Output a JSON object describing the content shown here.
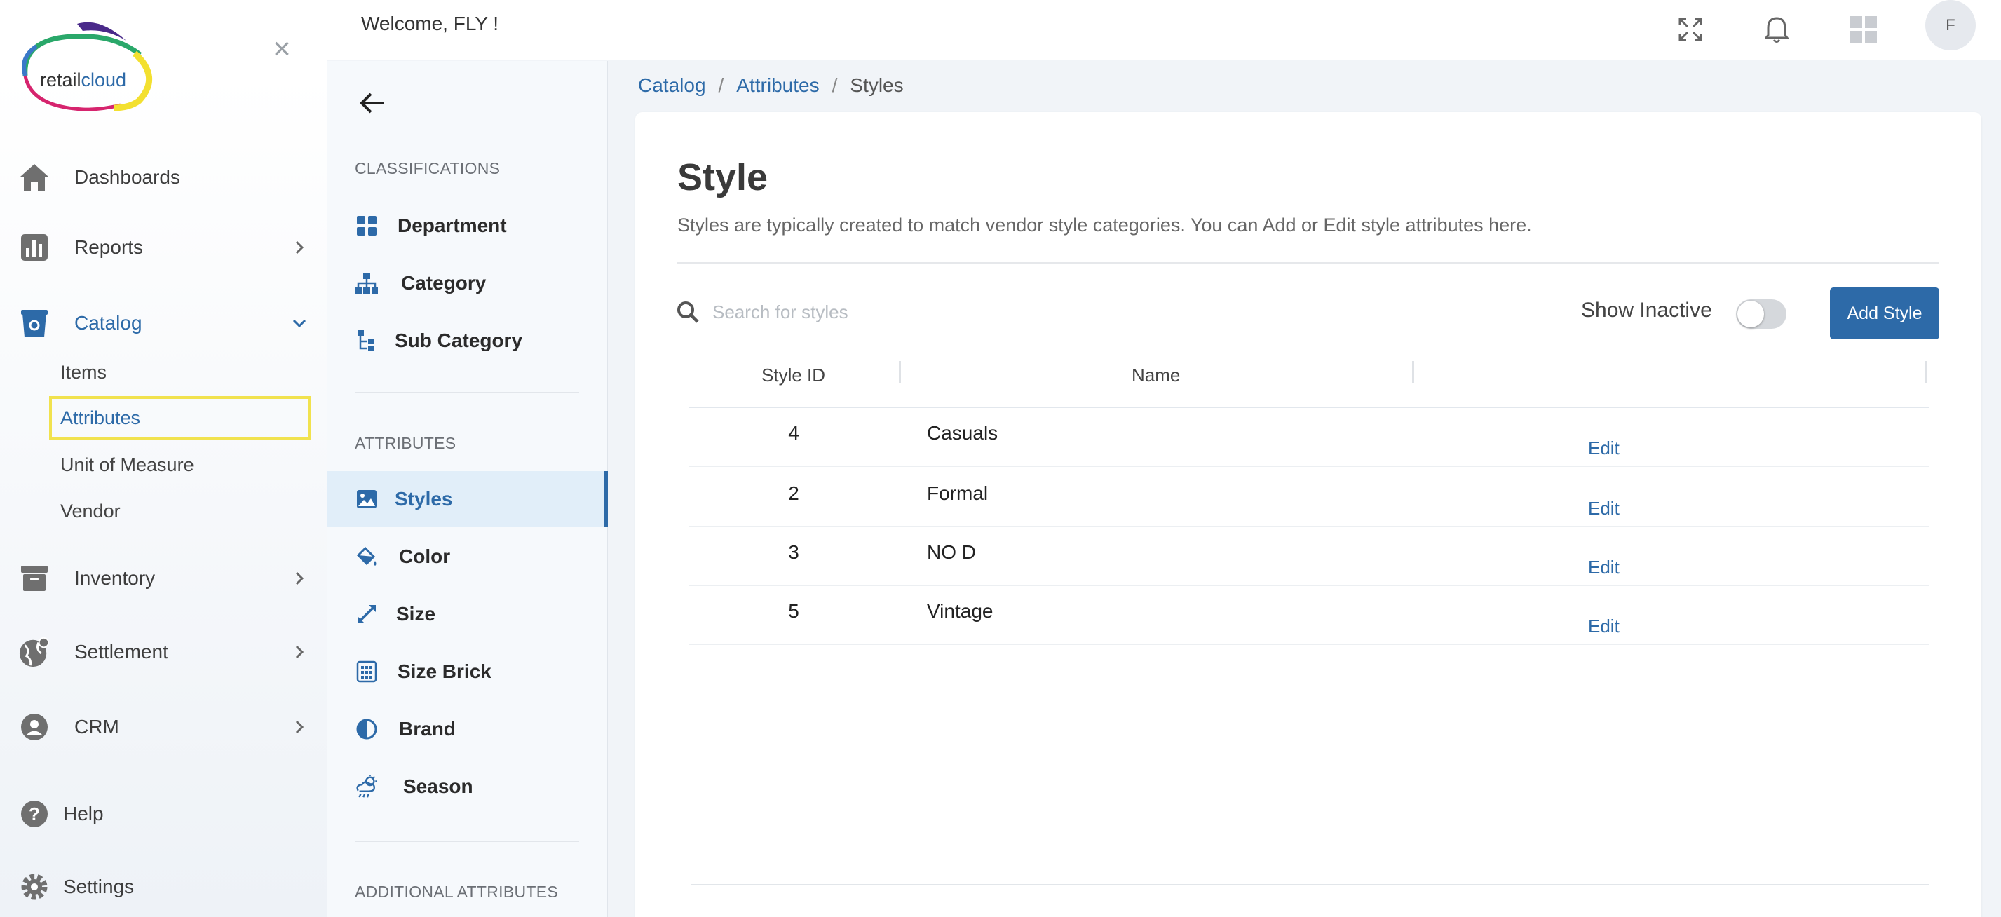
{
  "app": {
    "brand": "retailcloud",
    "brand_part1": "retail",
    "brand_part2": "cloud",
    "welcome": "Welcome, FLY !",
    "avatar_initial": "F"
  },
  "sidebar": {
    "items": [
      {
        "label": "Dashboards",
        "icon": "home-icon"
      },
      {
        "label": "Reports",
        "icon": "bar-chart-icon"
      },
      {
        "label": "Catalog",
        "icon": "catalog-bin-icon"
      },
      {
        "label": "Inventory",
        "icon": "archive-box-icon"
      },
      {
        "label": "Settlement",
        "icon": "globe-icon"
      },
      {
        "label": "CRM",
        "icon": "user-gear-icon"
      },
      {
        "label": "Help",
        "icon": "help-circle-icon"
      },
      {
        "label": "Settings",
        "icon": "gear-icon"
      }
    ],
    "catalog_sub": [
      "Items",
      "Attributes",
      "Unit of Measure",
      "Vendor"
    ]
  },
  "panel2": {
    "classifications_heading": "CLASSIFICATIONS",
    "classifications": [
      {
        "label": "Department",
        "icon": "grid-icon"
      },
      {
        "label": "Category",
        "icon": "hierarchy-icon"
      },
      {
        "label": "Sub Category",
        "icon": "tree-icon"
      }
    ],
    "attributes_heading": "ATTRIBUTES",
    "attributes": [
      {
        "label": "Styles",
        "icon": "image-icon"
      },
      {
        "label": "Color",
        "icon": "paint-bucket-icon"
      },
      {
        "label": "Size",
        "icon": "expand-arrows-icon"
      },
      {
        "label": "Size Brick",
        "icon": "calculator-icon"
      },
      {
        "label": "Brand",
        "icon": "contrast-icon"
      },
      {
        "label": "Season",
        "icon": "weather-icon"
      }
    ],
    "additional_heading": "ADDITIONAL ATTRIBUTES"
  },
  "breadcrumb": {
    "items": [
      "Catalog",
      "Attributes",
      "Styles"
    ],
    "separator": "/"
  },
  "page": {
    "title": "Style",
    "description": "Styles are typically created to match vendor style categories. You can Add or Edit style attributes here.",
    "search_placeholder": "Search for styles",
    "show_inactive_label": "Show Inactive",
    "show_inactive_on": false,
    "add_button": "Add Style"
  },
  "table": {
    "columns": [
      "Style ID",
      "Name",
      ""
    ],
    "rows": [
      {
        "id": "4",
        "name": "Casuals",
        "action": "Edit"
      },
      {
        "id": "2",
        "name": "Formal",
        "action": "Edit"
      },
      {
        "id": "3",
        "name": "NO D",
        "action": "Edit"
      },
      {
        "id": "5",
        "name": "Vintage",
        "action": "Edit"
      }
    ]
  },
  "colors": {
    "accent": "#2d6aa8",
    "highlight_border": "#f1e24e",
    "active_bg": "#e1eef9",
    "icon_gray": "#6f6f6f"
  }
}
